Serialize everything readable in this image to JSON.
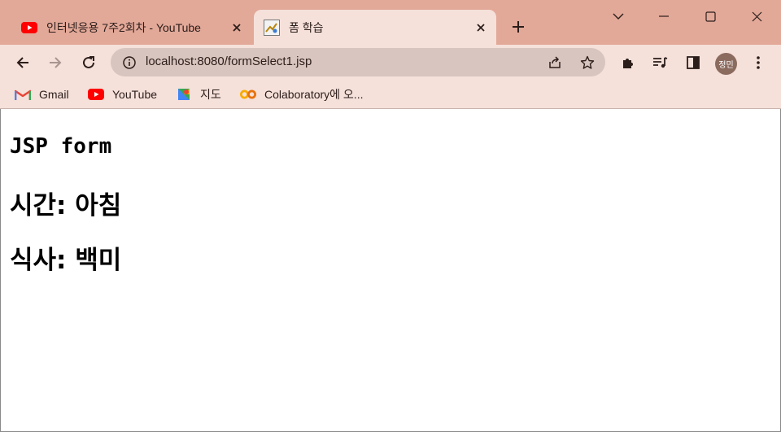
{
  "browser": {
    "tabs": [
      {
        "title": "인터넷응용 7주2회차 - YouTube",
        "icon": "youtube-icon",
        "active": false
      },
      {
        "title": "폼 학습",
        "icon": "jsp-page-icon",
        "active": true
      }
    ],
    "window_controls": [
      "tab-search-chevron-icon",
      "minimize-icon",
      "maximize-icon",
      "close-icon"
    ],
    "address": "localhost:8080/formSelect1.jsp",
    "profile_initials": "정민",
    "bookmarks": [
      {
        "label": "Gmail",
        "icon": "gmail-icon"
      },
      {
        "label": "YouTube",
        "icon": "youtube-icon"
      },
      {
        "label": "지도",
        "icon": "maps-icon"
      },
      {
        "label": "Colaboratory에 오...",
        "icon": "colab-icon"
      }
    ],
    "colors": {
      "titlebar": "#e2a898",
      "toolbar": "#f5e0da",
      "omnibox": "#d9c5bf",
      "youtube_red": "#ff0000"
    }
  },
  "page": {
    "heading": "JSP form",
    "lines": [
      "시간: 아침",
      "식사: 백미"
    ]
  }
}
